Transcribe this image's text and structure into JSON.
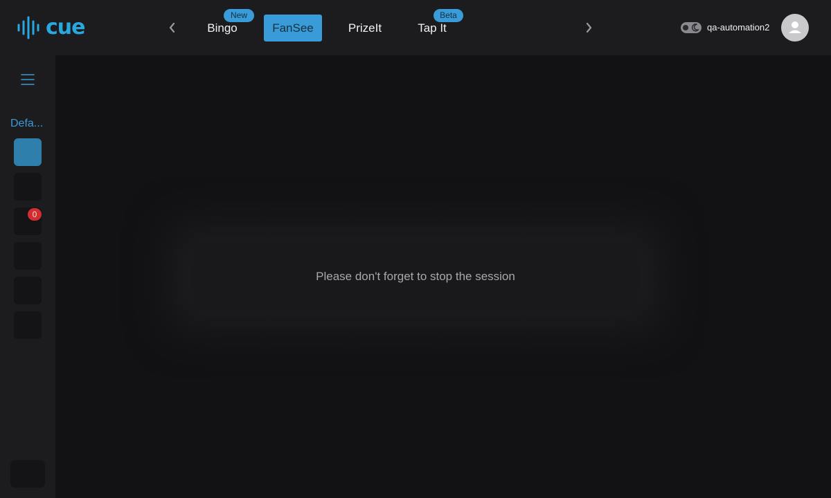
{
  "brand": {
    "logo_text": "cue",
    "accent": "#3a9bd9"
  },
  "nav": {
    "prev_icon": "chevron-left-icon",
    "next_icon": "chevron-right-icon",
    "tabs": [
      {
        "label": "Bingo",
        "badge": "New",
        "active": false
      },
      {
        "label": "FanSee",
        "badge": "",
        "active": true
      },
      {
        "label": "PrizeIt",
        "badge": "",
        "active": false
      },
      {
        "label": "Tap It",
        "badge": "Beta",
        "active": false
      }
    ]
  },
  "user": {
    "username": "qa-automation2",
    "theme_toggle_icon": "moon-icon",
    "avatar_icon": "user-icon"
  },
  "sidebar": {
    "menu_icon": "hamburger-icon",
    "group_label": "Defa...",
    "notification_count": "0"
  },
  "main": {
    "notice_text": "Please don't forget to stop the session"
  }
}
